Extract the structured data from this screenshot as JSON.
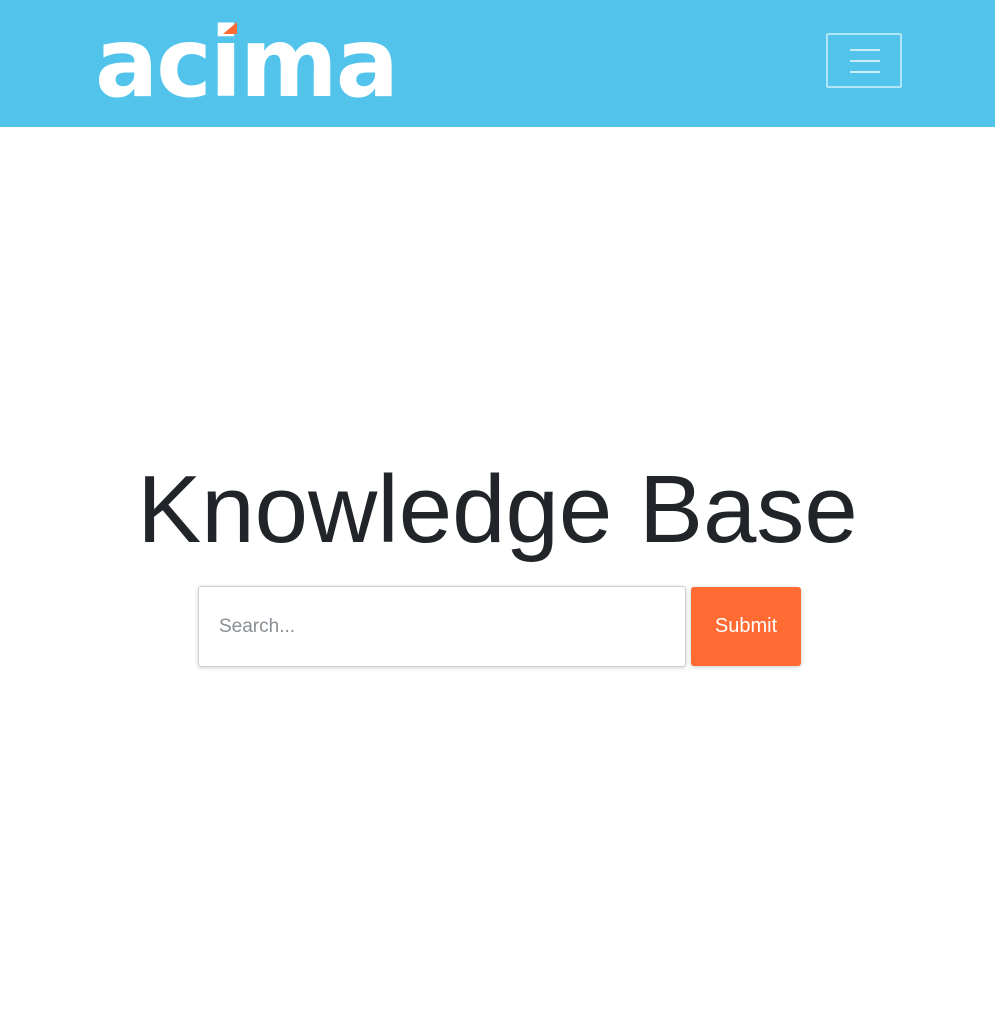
{
  "header": {
    "brand": "acima",
    "background_color": "#52c4eb",
    "logo_accent_color": "#ff6b32",
    "menu_icon": "hamburger-menu-icon"
  },
  "hero": {
    "title": "Knowledge Base"
  },
  "search": {
    "placeholder": "Search...",
    "value": "",
    "submit_label": "Submit",
    "submit_color": "#ff6b32"
  }
}
